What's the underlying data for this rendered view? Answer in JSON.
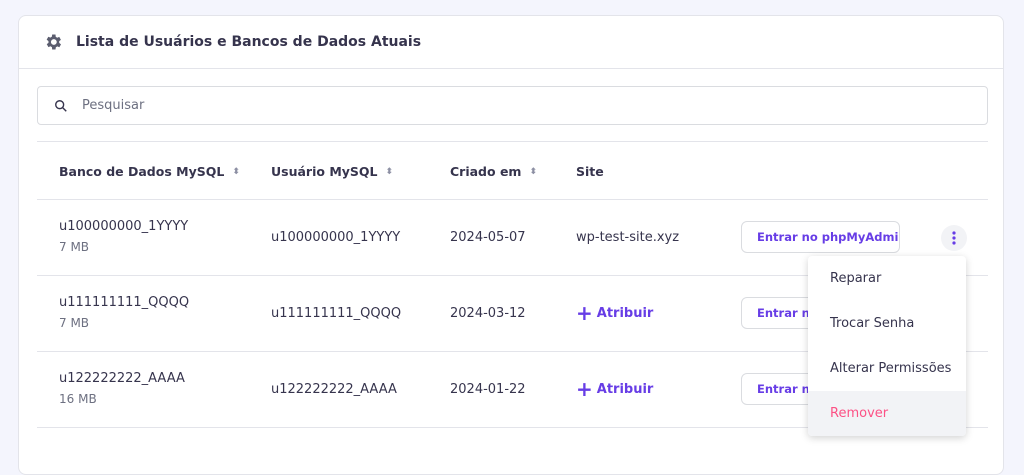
{
  "header": {
    "title": "Lista de Usuários e Bancos de Dados Atuais",
    "icon": "gear-icon"
  },
  "search": {
    "placeholder": "Pesquisar",
    "value": ""
  },
  "table": {
    "columns": [
      "Banco de Dados MySQL",
      "Usuário MySQL",
      "Criado em",
      "Site"
    ],
    "rows": [
      {
        "db": "u100000000_1YYYY",
        "size": "7 MB",
        "user": "u100000000_1YYYY",
        "created": "2024-05-07",
        "site": "wp-test-site.xyz",
        "button": "Entrar no phpMyAdmin"
      },
      {
        "db": "u111111111_QQQQ",
        "size": "7 MB",
        "user": "u111111111_QQQQ",
        "created": "2024-03-12",
        "site": "Atribuir",
        "button": "Entrar no phpMyAdmin"
      },
      {
        "db": "u122222222_AAAA",
        "size": "16 MB",
        "user": "u122222222_AAAA",
        "created": "2024-01-22",
        "site": "Atribuir",
        "button": "Entrar no phpMyAdmin"
      }
    ]
  },
  "menu": {
    "items": [
      "Reparar",
      "Trocar Senha",
      "Alterar Permissões",
      "Remover"
    ]
  },
  "colors": {
    "accent": "#673de6",
    "danger": "#fc5185"
  }
}
